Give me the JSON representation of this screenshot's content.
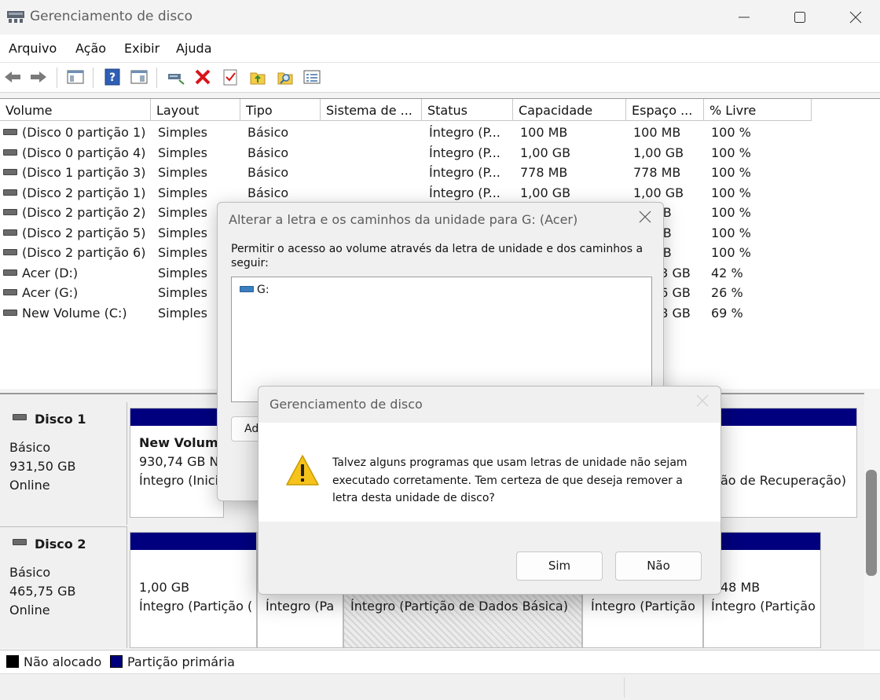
{
  "window": {
    "title": "Gerenciamento de disco"
  },
  "menu": [
    "Arquivo",
    "Ação",
    "Exibir",
    "Ajuda"
  ],
  "columns": [
    "Volume",
    "Layout",
    "Tipo",
    "Sistema de ...",
    "Status",
    "Capacidade",
    "Espaço ...",
    "% Livre"
  ],
  "volumes": [
    {
      "name": "(Disco 0 partição 1)",
      "layout": "Simples",
      "type": "Básico",
      "status": "Íntegro (P...",
      "capacity": "100 MB",
      "free": "100 MB",
      "pct": "100 %"
    },
    {
      "name": "(Disco 0 partição 4)",
      "layout": "Simples",
      "type": "Básico",
      "status": "Íntegro (P...",
      "capacity": "1,00 GB",
      "free": "1,00 GB",
      "pct": "100 %"
    },
    {
      "name": "(Disco 1 partição 3)",
      "layout": "Simples",
      "type": "Básico",
      "status": "Íntegro (P...",
      "capacity": "778 MB",
      "free": "778 MB",
      "pct": "100 %"
    },
    {
      "name": "(Disco 2 partição 1)",
      "layout": "Simples",
      "type": "Básico",
      "status": "Íntegro (P...",
      "capacity": "1,00 GB",
      "free": "1,00 GB",
      "pct": "100 %"
    },
    {
      "name": "(Disco 2 partição 2)",
      "layout": "Simples",
      "type": "",
      "status": "",
      "capacity": "",
      "free": "MB",
      "pct": "100 %"
    },
    {
      "name": "(Disco 2 partição 5)",
      "layout": "Simples",
      "type": "",
      "status": "",
      "capacity": "",
      "free": "MB",
      "pct": "100 %"
    },
    {
      "name": "(Disco 2 partição 6)",
      "layout": "Simples",
      "type": "",
      "status": "",
      "capacity": "",
      "free": "MB",
      "pct": "100 %"
    },
    {
      "name": "Acer (D:)",
      "layout": "Simples",
      "type": "",
      "status": "",
      "capacity": "",
      "free": "33 GB",
      "pct": "42 %"
    },
    {
      "name": "Acer (G:)",
      "layout": "Simples",
      "type": "",
      "status": "",
      "capacity": "",
      "free": "56 GB",
      "pct": "26 %"
    },
    {
      "name": "New Volume (C:)",
      "layout": "Simples",
      "type": "",
      "status": "",
      "capacity": "",
      "free": "38 GB",
      "pct": "69 %"
    }
  ],
  "disks": {
    "disk1": {
      "name": "Disco 1",
      "type": "Básico",
      "size": "931,50 GB",
      "state": "Online",
      "part_a": {
        "l1": "New Volum",
        "l2": "930,74 GB N",
        "l3": "Íntegro (Inici"
      },
      "part_b": {
        "l3": "ão de Recuperação)"
      }
    },
    "disk2": {
      "name": "Disco 2",
      "type": "Básico",
      "size": "465,75 GB",
      "state": "Online",
      "p1": {
        "l2": "1,00 GB",
        "l3": "Íntegro (Partição ("
      },
      "p2": {
        "l3": "Íntegro (Pa"
      },
      "p3": {
        "l3": "Íntegro (Partição de Dados Básica)"
      },
      "p4": {
        "l3": "Íntegro (Partição"
      },
      "p5": {
        "l2": "48 MB",
        "l3": "Íntegro (Partição"
      }
    }
  },
  "legend": {
    "unallocated": "Não alocado",
    "primary": "Partição primária",
    "unallocated_color": "#000000",
    "primary_color": "#00007f"
  },
  "dialog_paths": {
    "title": "Alterar a letra e os caminhos da unidade para G: (Acer)",
    "description": "Permitir o acesso ao volume através da letra de unidade e dos caminhos a seguir:",
    "items": [
      "G:"
    ],
    "add_label": "Ad"
  },
  "dialog_confirm": {
    "title": "Gerenciamento de disco",
    "message": "Talvez alguns programas que usam letras de unidade não sejam executado corretamente. Tem certeza de que deseja remover a letra desta unidade de disco?",
    "yes": "Sim",
    "no": "Não"
  },
  "icons": [
    "back-icon",
    "forward-icon",
    "show-hide-console-icon",
    "help-icon",
    "properties-icon",
    "connect-icon",
    "delete-icon",
    "checklist-icon",
    "folder-up-icon",
    "folder-search-icon",
    "list-icon",
    "warning-icon"
  ]
}
